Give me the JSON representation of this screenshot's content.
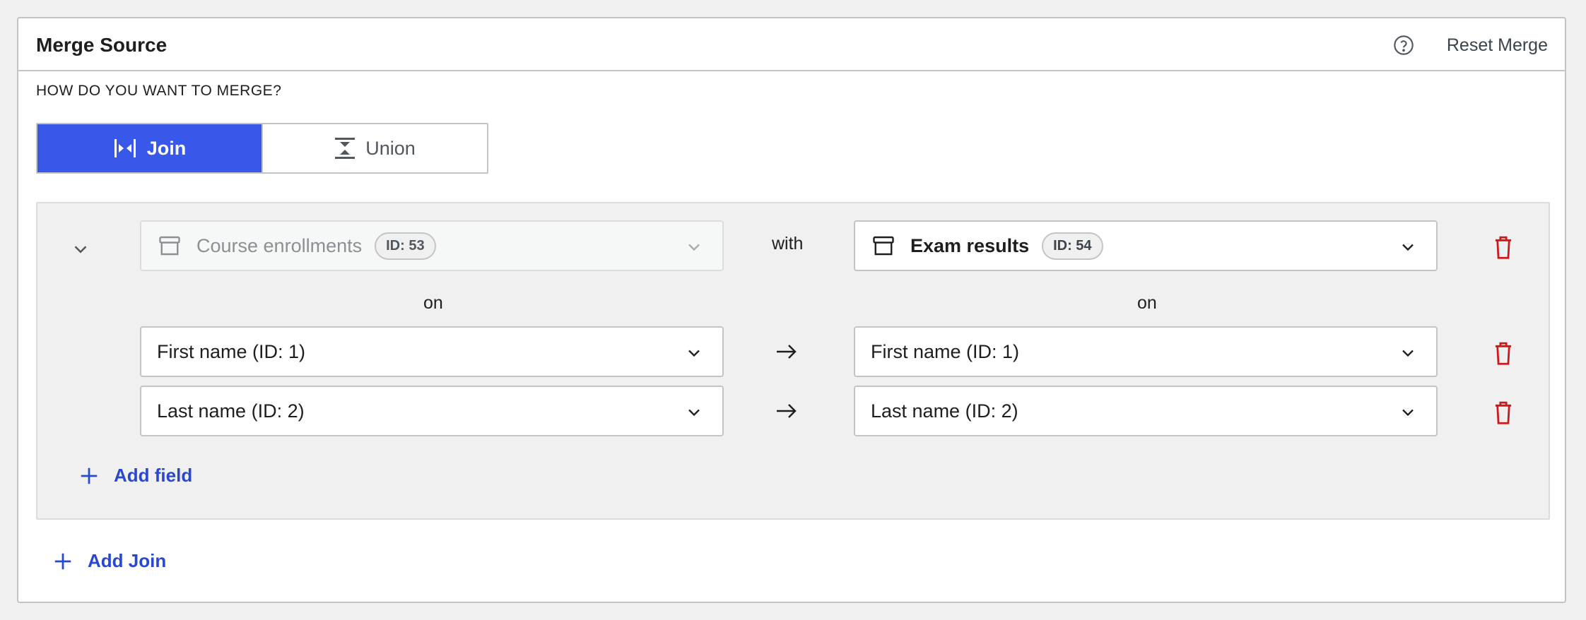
{
  "header": {
    "title": "Merge Source",
    "help_icon": "help-circle-icon",
    "reset_label": "Reset Merge"
  },
  "merge_question": "HOW DO YOU WANT TO MERGE?",
  "merge_type": {
    "options": [
      {
        "label": "Join",
        "icon": "join-icon",
        "selected": true
      },
      {
        "label": "Union",
        "icon": "union-icon",
        "selected": false
      }
    ]
  },
  "join": {
    "source": {
      "label": "Course enrollments",
      "id_badge": "ID: 53",
      "disabled": true
    },
    "with_label": "with",
    "target": {
      "label": "Exam results",
      "id_badge": "ID: 54"
    },
    "on_left": "on",
    "on_right": "on",
    "field_pairs": [
      {
        "left": "First name (ID: 1)",
        "right": "First name (ID: 1)"
      },
      {
        "left": "Last name (ID: 2)",
        "right": "Last name (ID: 2)"
      }
    ],
    "add_field_label": "Add field"
  },
  "add_join_label": "Add Join",
  "colors": {
    "accent": "#3858e9",
    "link": "#2848d0",
    "danger": "#cc1818",
    "border": "#c3c4c7",
    "join_bg": "#f0f0f1"
  }
}
